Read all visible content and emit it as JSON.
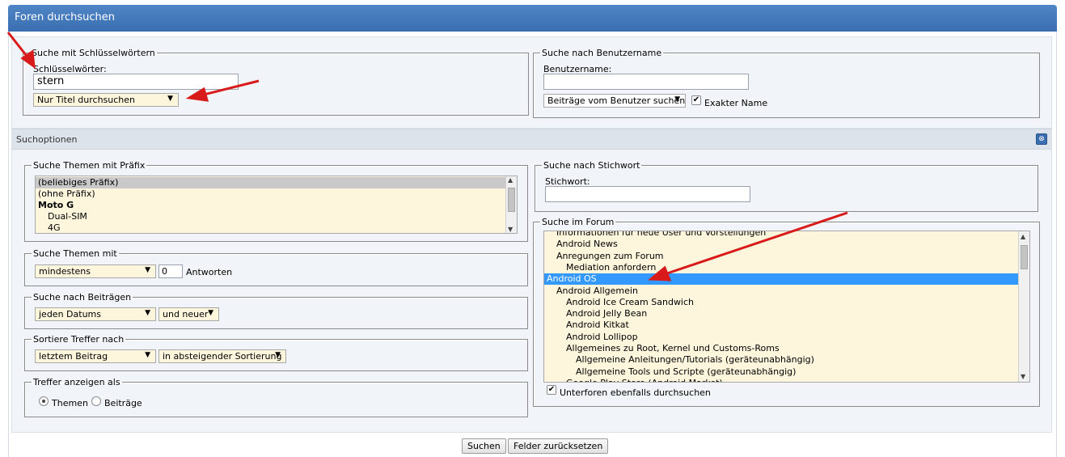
{
  "title": "Foren durchsuchen",
  "keywords": {
    "legend": "Suche mit Schlüsselwörtern",
    "label": "Schlüsselwörter:",
    "value": "stern",
    "mode": "Nur Titel durchsuchen"
  },
  "user": {
    "legend": "Suche nach Benutzername",
    "label": "Benutzername:",
    "value": "",
    "mode": "Beiträge vom Benutzer suchen",
    "exact_label": "Exakter Name",
    "exact_checked": true
  },
  "options_title": "Suchoptionen",
  "prefix": {
    "legend": "Suche Themen mit Präfix",
    "items": [
      {
        "label": "(beliebiges Präfix)",
        "selected": true,
        "bold": false,
        "indent": 0
      },
      {
        "label": "(ohne Präfix)",
        "selected": false,
        "bold": false,
        "indent": 0
      },
      {
        "label": "Moto G",
        "selected": false,
        "bold": true,
        "indent": 0
      },
      {
        "label": "Dual-SIM",
        "selected": false,
        "bold": false,
        "indent": 1
      },
      {
        "label": "4G",
        "selected": false,
        "bold": false,
        "indent": 1
      }
    ]
  },
  "replies": {
    "legend": "Suche Themen mit",
    "mode": "mindestens",
    "count": "0",
    "suffix": "Antworten"
  },
  "posts": {
    "legend": "Suche nach Beiträgen",
    "date": "jeden Datums",
    "direction": "und neuer"
  },
  "sort": {
    "legend": "Sortiere Treffer nach",
    "field": "letztem Beitrag",
    "order": "in absteigender Sortierung"
  },
  "display": {
    "legend": "Treffer anzeigen als",
    "options": [
      {
        "label": "Themen",
        "checked": true
      },
      {
        "label": "Beiträge",
        "checked": false
      }
    ]
  },
  "tag": {
    "legend": "Suche nach Stichwort",
    "label": "Stichwort:",
    "value": ""
  },
  "forum": {
    "legend": "Suche im Forum",
    "items": [
      {
        "label": "Informationen für neue User und Vorstellungen",
        "indent": 1,
        "selected": false
      },
      {
        "label": "Android News",
        "indent": 1,
        "selected": false
      },
      {
        "label": "Anregungen zum Forum",
        "indent": 1,
        "selected": false
      },
      {
        "label": "Mediation anfordern",
        "indent": 2,
        "selected": false
      },
      {
        "label": "Android OS",
        "indent": 0,
        "selected": true
      },
      {
        "label": "Android Allgemein",
        "indent": 1,
        "selected": false
      },
      {
        "label": "Android Ice Cream Sandwich",
        "indent": 2,
        "selected": false
      },
      {
        "label": "Android Jelly Bean",
        "indent": 2,
        "selected": false
      },
      {
        "label": "Android Kitkat",
        "indent": 2,
        "selected": false
      },
      {
        "label": "Android Lollipop",
        "indent": 2,
        "selected": false
      },
      {
        "label": "Allgemeines zu Root, Kernel und Customs-Roms",
        "indent": 2,
        "selected": false
      },
      {
        "label": "Allgemeine Anleitungen/Tutorials (geräteunabhängig)",
        "indent": 3,
        "selected": false
      },
      {
        "label": "Allgemeine Tools und Scripte (geräteunabhängig)",
        "indent": 3,
        "selected": false
      },
      {
        "label": "Google Play Store (Android Market)",
        "indent": 2,
        "selected": false
      }
    ],
    "subforums_label": "Unterforen ebenfalls durchsuchen",
    "subforums_checked": true
  },
  "buttons": {
    "search": "Suchen",
    "reset": "Felder zurücksetzen"
  },
  "colors": {
    "header": "#3a6eb0",
    "selected_row": "#3399ff",
    "field_bg": "#fdf6dd",
    "annotation_arrow": "#d91a1a"
  }
}
